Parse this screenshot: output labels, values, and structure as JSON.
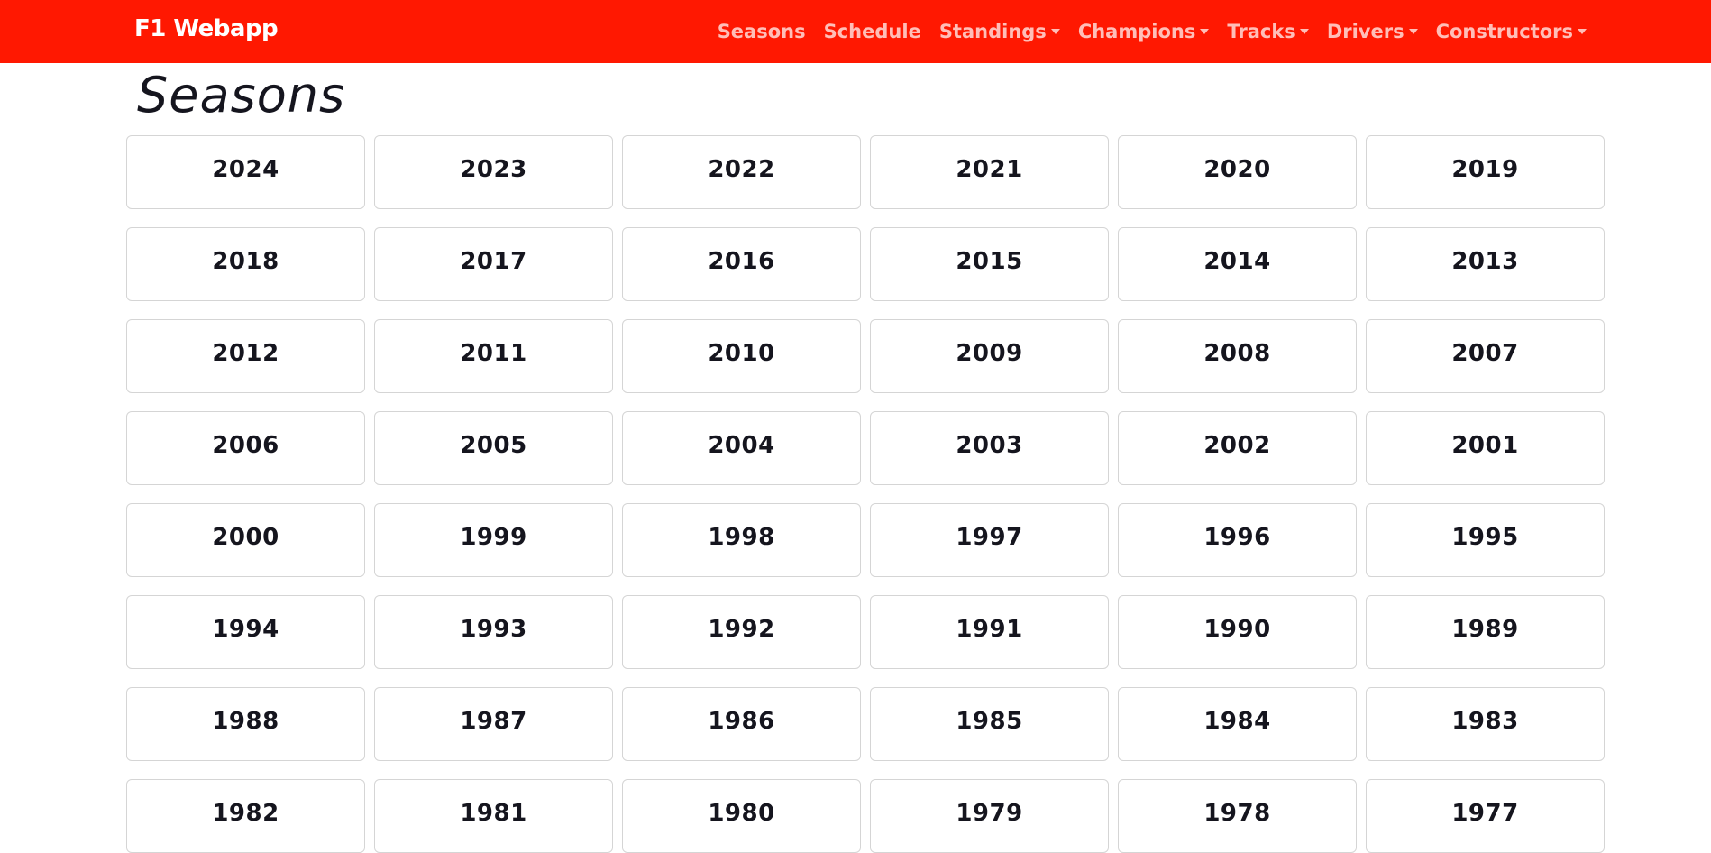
{
  "navbar": {
    "brand": "F1 Webapp",
    "links": [
      {
        "label": "Seasons",
        "dropdown": false
      },
      {
        "label": "Schedule",
        "dropdown": false
      },
      {
        "label": "Standings",
        "dropdown": true
      },
      {
        "label": "Champions",
        "dropdown": true
      },
      {
        "label": "Tracks",
        "dropdown": true
      },
      {
        "label": "Drivers",
        "dropdown": true
      },
      {
        "label": "Constructors",
        "dropdown": true
      }
    ]
  },
  "page": {
    "title": "Seasons"
  },
  "seasons": [
    "2024",
    "2023",
    "2022",
    "2021",
    "2020",
    "2019",
    "2018",
    "2017",
    "2016",
    "2015",
    "2014",
    "2013",
    "2012",
    "2011",
    "2010",
    "2009",
    "2008",
    "2007",
    "2006",
    "2005",
    "2004",
    "2003",
    "2002",
    "2001",
    "2000",
    "1999",
    "1998",
    "1997",
    "1996",
    "1995",
    "1994",
    "1993",
    "1992",
    "1991",
    "1990",
    "1989",
    "1988",
    "1987",
    "1986",
    "1985",
    "1984",
    "1983",
    "1982",
    "1981",
    "1980",
    "1979",
    "1978",
    "1977"
  ],
  "colors": {
    "navbar_bg": "#ff1801",
    "text_dark": "#15151e",
    "card_border": "#d5d5d5"
  }
}
